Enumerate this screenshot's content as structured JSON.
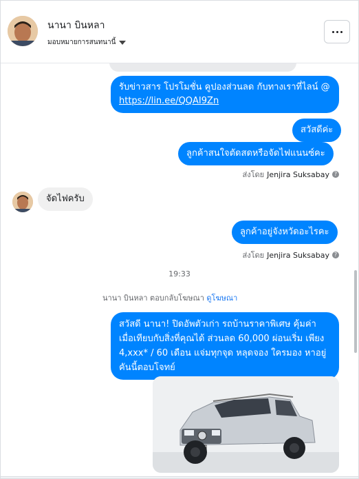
{
  "header": {
    "name": "นานา บินหลา",
    "assign_label": "มอบหมายการสนทนานี้"
  },
  "messages": {
    "promo_text": "รับข่าวสาร  โปรโมชั่น คูปองส่วนลด กับทางเราที่ไลน์ @ ",
    "promo_link": "https://lin.ee/QQAI9Zn",
    "greeting": "สวัสดีค่ะ",
    "question1": "ลูกค้าสนใจตัดสดหรือจัดไฟแนนซ์คะ",
    "sent_by_prefix": "ส่งโดย",
    "sent_by_name": "Jenjira Suksabay",
    "customer_reply": "จัดไฟครับ",
    "question2": "ลูกค้าอยู่จังหวัดอะไรคะ",
    "time": "19:33",
    "ad_reply_prefix": "นานา บินหลา ตอบกลับโฆษณา",
    "ad_link": "ดูโฆษณา",
    "ad_text": "สวัสดี นานา! ปิดอัพตัวเก่า รถบ้านราคาพิเศษ คุ้มค่า เมื่อเทียบกับสิ่งที่คุณได้  ส่วนลด 60,000 ผ่อนเริ่ม เพียง 4,xxx* / 60 เดือน แจ่มทุกจุด หลุดจอง ใครมอง หาอยู่ คันนี้ตอบโจทย์"
  },
  "colors": {
    "outgoing_bubble": "#0084ff",
    "incoming_bubble": "#f0f0f0",
    "link": "#1877f2",
    "car_body": "#c9ced4"
  },
  "icons": [
    "chevron-down-icon",
    "more-icon",
    "info-icon"
  ]
}
